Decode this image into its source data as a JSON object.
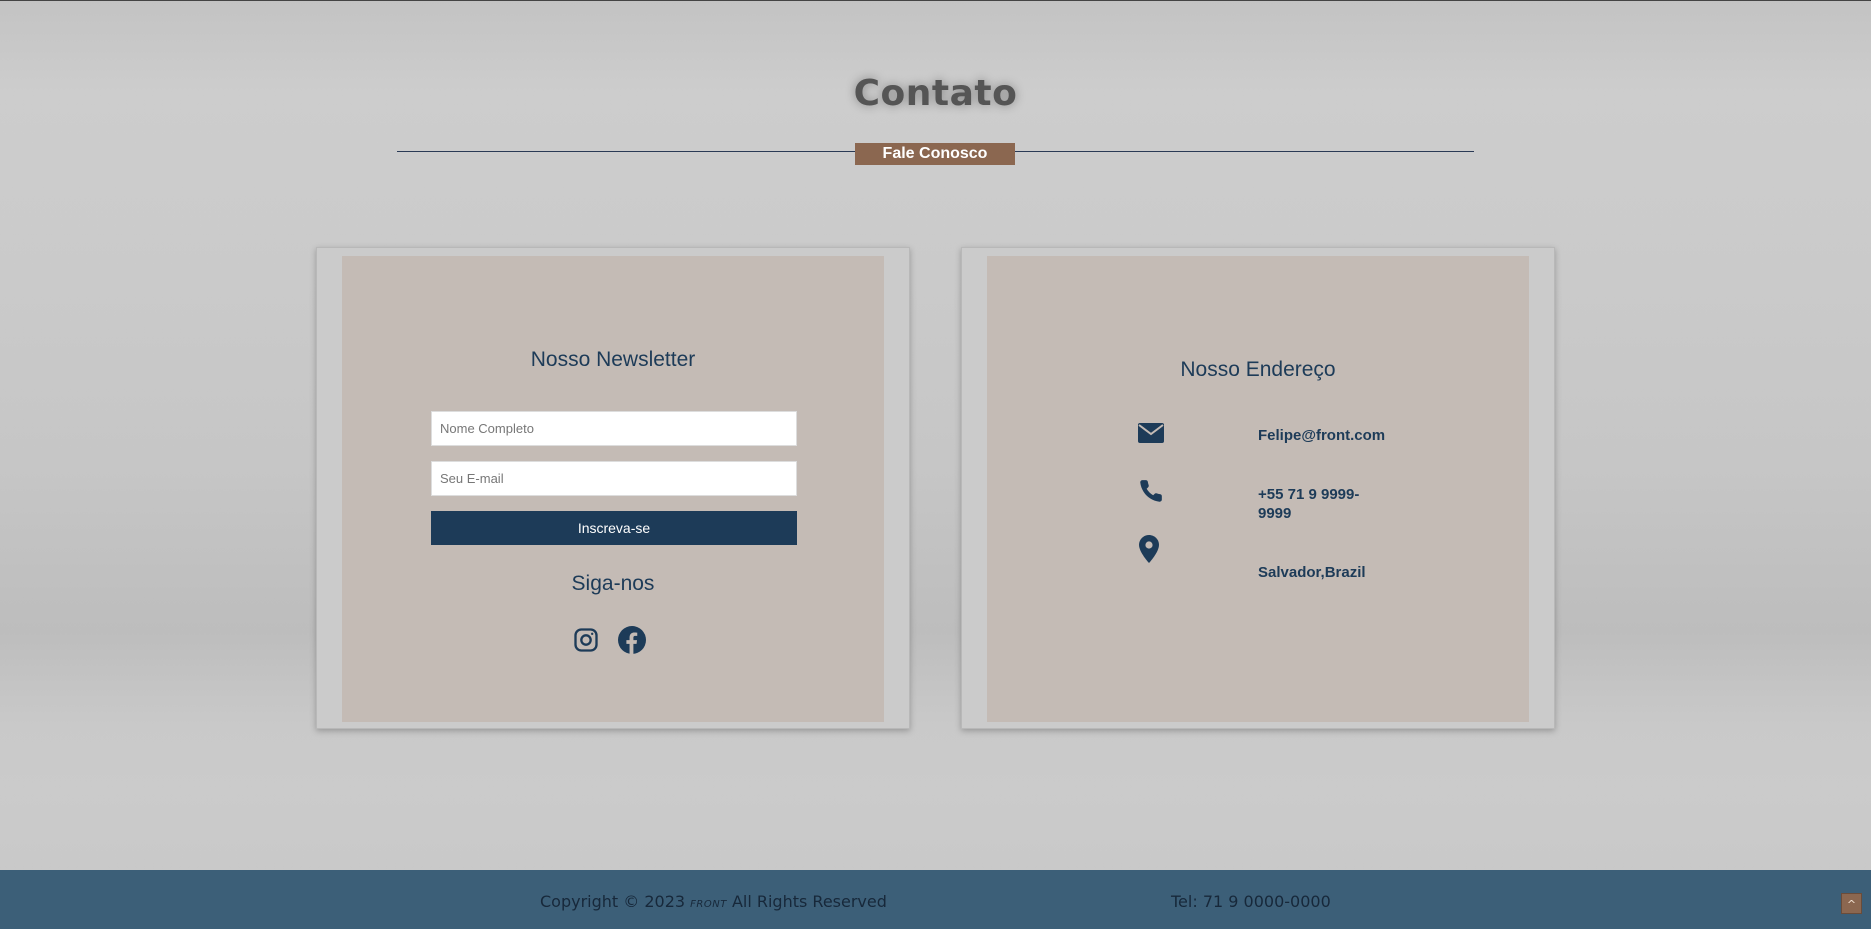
{
  "header": {
    "title": "Contato",
    "subtitle_badge": "Fale Conosco"
  },
  "newsletter": {
    "heading": "Nosso Newsletter",
    "name_placeholder": "Nome Completo",
    "email_placeholder": "Seu E-mail",
    "subscribe_label": "Inscreva-se",
    "follow_heading": "Siga-nos",
    "social_icons": [
      "instagram-icon",
      "facebook-icon"
    ]
  },
  "address": {
    "heading": "Nosso Endereço",
    "email": "Felipe@front.com",
    "phone": "+55 71 9 9999-9999",
    "location": "Salvador,Brazil",
    "icons": [
      "envelope-icon",
      "phone-icon",
      "map-pin-icon"
    ]
  },
  "footer": {
    "copyright_prefix": "Copyright © 2023",
    "brand": "FRONT",
    "copyright_suffix": "All Rights Reserved",
    "tel": "Tel: 71 9 0000-0000",
    "back_to_top": "^"
  },
  "colors": {
    "accent_brown": "#8b6750",
    "navy": "#1d3b58",
    "card_bg": "#c4bbb5",
    "footer_bg": "#3c5f78"
  }
}
